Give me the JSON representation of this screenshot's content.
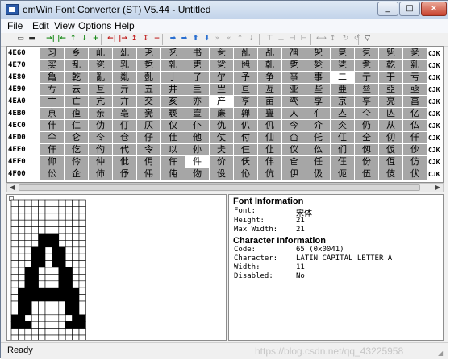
{
  "window": {
    "title": "emWin Font Converter (ST) V5.44 - Untitled",
    "controls": [
      "_",
      "□",
      "×"
    ]
  },
  "menu": [
    "File",
    "Edit",
    "View",
    "Options",
    "Help"
  ],
  "toolbar": {
    "icons": [
      "new-icon",
      "save-icon",
      "add-left-icon",
      "add-right-icon",
      "add-up-icon",
      "add-down-icon",
      "add-plus-icon",
      "remove-left-icon",
      "remove-right-icon",
      "remove-up-icon",
      "remove-down-icon",
      "remove-minus-icon",
      "arrow-left-icon",
      "arrow-right-icon",
      "arrow-up-icon",
      "arrow-down-icon",
      "move-right-icon",
      "move-left-icon",
      "move-up-icon",
      "move-down-icon",
      "shrink-top-icon",
      "shrink-bottom-icon",
      "shrink-left-icon",
      "shrink-right-icon",
      "flip-h-icon",
      "flip-v-icon",
      "rotate-icon",
      "rotate-back-icon",
      "filter-icon"
    ],
    "glyphs": [
      "▭",
      "▬",
      "→|",
      "|←",
      "↑",
      "↓",
      "+",
      "←|",
      "|→",
      "↥",
      "↧",
      "−",
      "➡",
      "➡",
      "⬆",
      "⬇",
      "»",
      "«",
      "⇡",
      "⇣",
      "⊤",
      "⊥",
      "⊣",
      "⊢",
      "⟷",
      "↕",
      "↻",
      "↺",
      "▽"
    ]
  },
  "char_grid": {
    "rows": [
      {
        "code": "4E60",
        "chars": [
          "习",
          "乡",
          "乢",
          "乣",
          "乤",
          "乥",
          "书",
          "乧",
          "乨",
          "乩",
          "乪",
          "乫",
          "乬",
          "乭",
          "乮",
          "乯"
        ]
      },
      {
        "code": "4E70",
        "chars": [
          "买",
          "乱",
          "乲",
          "乳",
          "乴",
          "乵",
          "乶",
          "乷",
          "乸",
          "乹",
          "乺",
          "乻",
          "乼",
          "乽",
          "乾",
          "乿"
        ]
      },
      {
        "code": "4E80",
        "chars": [
          "亀",
          "亁",
          "亂",
          "亃",
          "亄",
          "亅",
          "了",
          "亇",
          "予",
          "争",
          "亊",
          "事",
          "二",
          "亍",
          "于",
          "亏"
        ]
      },
      {
        "code": "4E90",
        "chars": [
          "亐",
          "云",
          "互",
          "亓",
          "五",
          "井",
          "亖",
          "亗",
          "亘",
          "亙",
          "亚",
          "些",
          "亜",
          "亝",
          "亞",
          "亟"
        ]
      },
      {
        "code": "4EA0",
        "chars": [
          "亠",
          "亡",
          "亢",
          "亣",
          "交",
          "亥",
          "亦",
          "产",
          "亨",
          "亩",
          "亪",
          "享",
          "京",
          "亭",
          "亮",
          "亯"
        ]
      },
      {
        "code": "4EB0",
        "chars": [
          "亰",
          "亱",
          "亲",
          "亳",
          "亴",
          "亵",
          "亶",
          "亷",
          "亸",
          "亹",
          "人",
          "亻",
          "亼",
          "亽",
          "亾",
          "亿"
        ]
      },
      {
        "code": "4EC0",
        "chars": [
          "什",
          "仁",
          "仂",
          "仃",
          "仄",
          "仅",
          "仆",
          "仇",
          "仈",
          "仉",
          "今",
          "介",
          "仌",
          "仍",
          "从",
          "仏"
        ]
      },
      {
        "code": "4ED0",
        "chars": [
          "仐",
          "仑",
          "仒",
          "仓",
          "仔",
          "仕",
          "他",
          "仗",
          "付",
          "仙",
          "仚",
          "仛",
          "仜",
          "仝",
          "仞",
          "仟"
        ]
      },
      {
        "code": "4EE0",
        "chars": [
          "仠",
          "仡",
          "仢",
          "代",
          "令",
          "以",
          "仦",
          "仧",
          "仨",
          "仩",
          "仪",
          "仫",
          "们",
          "仭",
          "仮",
          "仯"
        ]
      },
      {
        "code": "4EF0",
        "chars": [
          "仰",
          "仱",
          "仲",
          "仳",
          "仴",
          "仵",
          "件",
          "价",
          "仸",
          "仹",
          "仺",
          "任",
          "仼",
          "份",
          "仾",
          "仿"
        ]
      },
      {
        "code": "4F00",
        "chars": [
          "伀",
          "企",
          "伂",
          "伃",
          "伄",
          "伅",
          "伆",
          "伇",
          "伈",
          "伉",
          "伊",
          "伋",
          "伌",
          "伍",
          "伎",
          "伏"
        ]
      }
    ],
    "selected": [
      {
        "row": 2,
        "col": 12
      },
      {
        "row": 4,
        "col": 7
      },
      {
        "row": 9,
        "col": 6
      }
    ],
    "right_label": "CJK"
  },
  "glyph_bitmap": {
    "cols": 11,
    "rows": 21,
    "pixels": [
      "00000000000",
      "00000000000",
      "00000000000",
      "00000000000",
      "00000000000",
      "00001110000",
      "00001110000",
      "00011011000",
      "00011011000",
      "00011011000",
      "00110001100",
      "00110001100",
      "00110001100",
      "01111111110",
      "01111111110",
      "01100000110",
      "01100000110",
      "11000000011",
      "11100000111",
      "00000000000",
      "00000000000"
    ]
  },
  "font_info": {
    "heading": "Font Information",
    "rows": [
      {
        "k": "Font:",
        "v": "宋体"
      },
      {
        "k": "Height:",
        "v": "21"
      },
      {
        "k": "Max Width:",
        "v": "21"
      }
    ]
  },
  "char_info": {
    "heading": "Character Information",
    "rows": [
      {
        "k": "Code:",
        "v": "65 (0x0041)"
      },
      {
        "k": "Character:",
        "v": "LATIN CAPITAL LETTER A"
      },
      {
        "k": "Width:",
        "v": "11"
      },
      {
        "k": "Disabled:",
        "v": "No"
      }
    ]
  },
  "status": {
    "text": "Ready",
    "watermark": "https://blog.csdn.net/qq_43225958"
  }
}
